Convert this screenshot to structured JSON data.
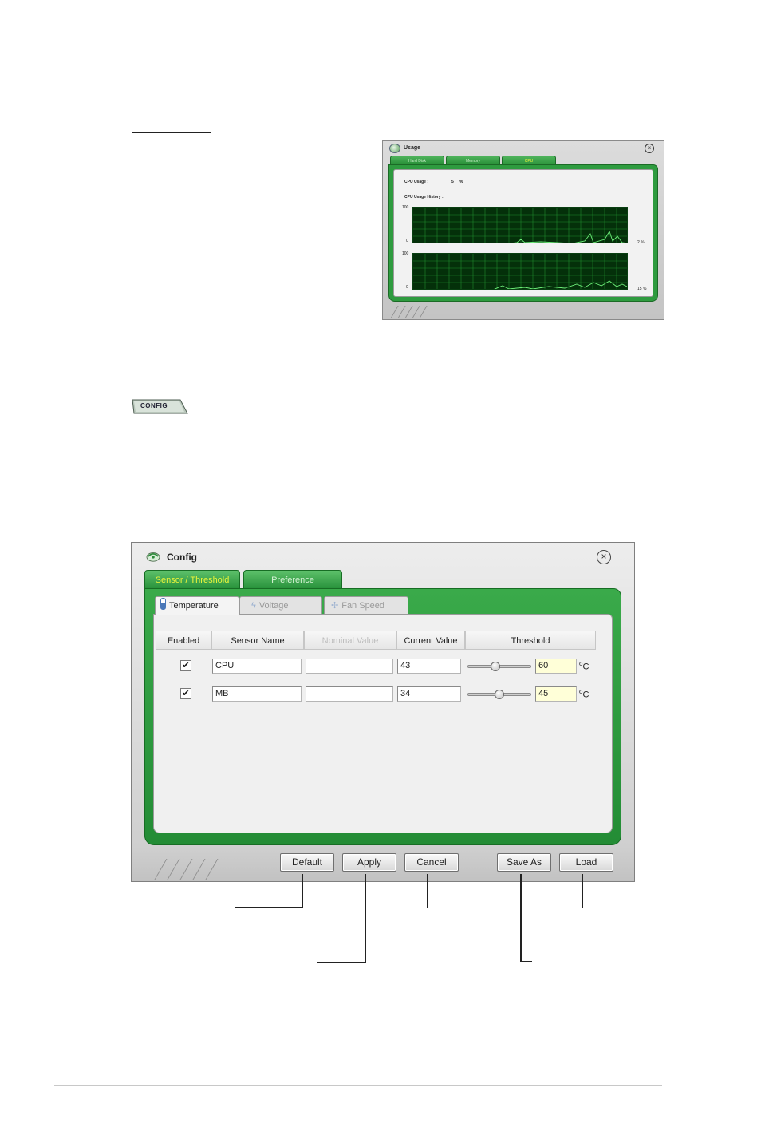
{
  "usage_window": {
    "title": "Usage",
    "tabs": [
      "Hard Disk",
      "Memory",
      "CPU"
    ],
    "cpu_usage_label": "CPU Usage :",
    "cpu_usage_value": "5",
    "cpu_usage_unit": "%",
    "history_label": "CPU Usage History :",
    "graph1": {
      "ymax": "100",
      "ymin": "0",
      "current": "2 %"
    },
    "graph2": {
      "ymax": "100",
      "ymin": "0",
      "current": "15 %"
    }
  },
  "config_button": {
    "label": "CONFIG"
  },
  "config_window": {
    "title": "Config",
    "tabs": [
      "Sensor / Threshold",
      "Preference"
    ],
    "subtabs": [
      "Temperature",
      "Voltage",
      "Fan Speed"
    ],
    "columns": [
      "Enabled",
      "Sensor Name",
      "Nominal Value",
      "Current Value",
      "Threshold"
    ],
    "rows": [
      {
        "enabled": true,
        "sensor_name": "CPU",
        "nominal": "",
        "current": "43",
        "threshold": "60",
        "unit": "C",
        "slider_level": 0.42
      },
      {
        "enabled": true,
        "sensor_name": "MB",
        "nominal": "",
        "current": "34",
        "threshold": "45",
        "unit": "C",
        "slider_level": 0.5
      }
    ],
    "buttons": {
      "default": "Default",
      "apply": "Apply",
      "cancel": "Cancel",
      "save_as": "Save As",
      "load": "Load"
    },
    "colors": {
      "frame_green": "#2e9b3f",
      "active_tab_text": "#ebf53a",
      "threshold_bg": "#ffffd8"
    }
  }
}
